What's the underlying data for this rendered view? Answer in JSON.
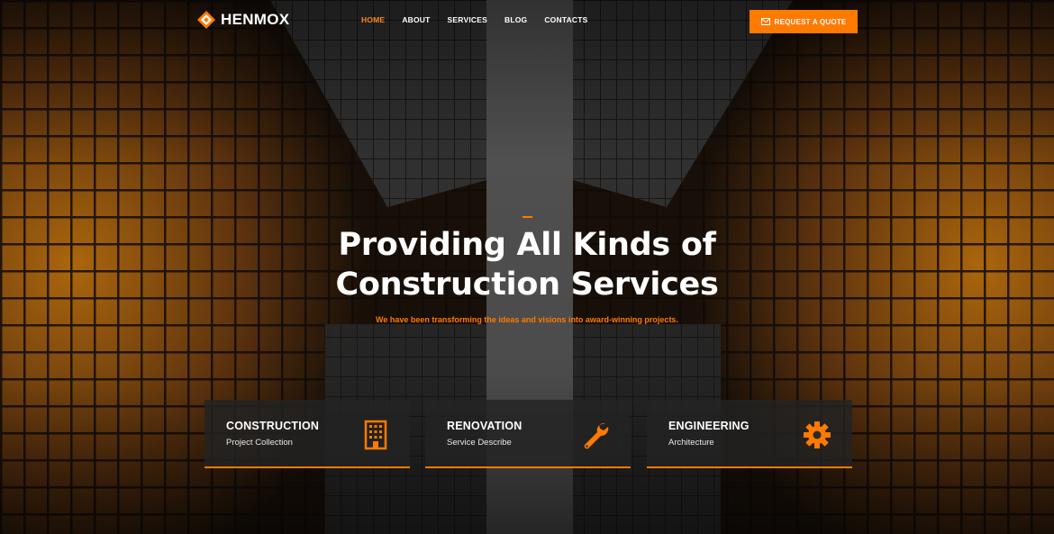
{
  "brand": {
    "name": "HENMOX"
  },
  "nav": {
    "items": [
      {
        "label": "HOME",
        "active": true
      },
      {
        "label": "ABOUT",
        "active": false
      },
      {
        "label": "SERVICES",
        "active": false
      },
      {
        "label": "BLOG",
        "active": false
      },
      {
        "label": "CONTACTS",
        "active": false
      }
    ]
  },
  "header": {
    "quote_button": "REQUEST A QUOTE"
  },
  "hero": {
    "title_line1": "Providing All Kinds of",
    "title_line2": "Construction Services",
    "subtitle": "We have been transforming the ideas and visions into award-winning projects."
  },
  "services": [
    {
      "title": "CONSTRUCTION",
      "subtitle": "Project Collection",
      "icon": "building-icon"
    },
    {
      "title": "RENOVATION",
      "subtitle": "Service Describe",
      "icon": "wrench-icon"
    },
    {
      "title": "ENGINEERING",
      "subtitle": "Architecture",
      "icon": "gear-icon"
    }
  ],
  "colors": {
    "accent": "#ff7a00",
    "card_bg": "#232323"
  }
}
